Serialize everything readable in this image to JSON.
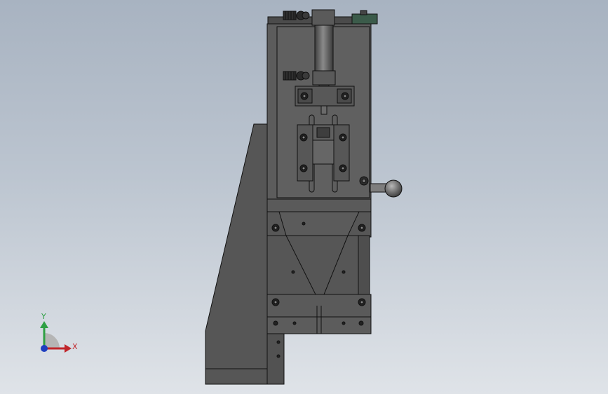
{
  "viewport": {
    "background_top": "#a8b3c1",
    "background_bottom": "#dfe3e8",
    "model_color": "#5a5a5a",
    "edge_color": "#111111"
  },
  "triad": {
    "x_label": "X",
    "y_label": "Y",
    "x_color": "#c0262b",
    "y_color": "#2ea043",
    "z_color": "#1f3fbf"
  }
}
